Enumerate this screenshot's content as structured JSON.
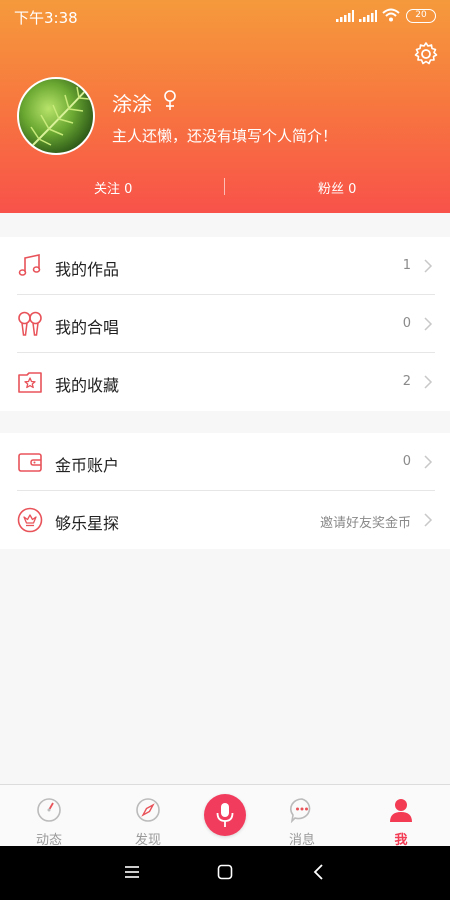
{
  "status_bar": {
    "time": "下午3:38",
    "battery": "20"
  },
  "profile": {
    "name": "涂涂",
    "bio": "主人还懒，还没有填写个人简介！",
    "following": "关注 0",
    "followers": "粉丝 0"
  },
  "menu_group_1": [
    {
      "label": "我的作品",
      "value": "1"
    },
    {
      "label": "我的合唱",
      "value": "0"
    },
    {
      "label": "我的收藏",
      "value": "2"
    }
  ],
  "menu_group_2": [
    {
      "label": "金币账户",
      "value": "0"
    },
    {
      "label": "够乐星探",
      "value": "邀请好友奖金币"
    }
  ],
  "tab_bar": {
    "tabs": [
      {
        "label": "动态",
        "icon": "speedometer-icon"
      },
      {
        "label": "发现",
        "icon": "compass-icon"
      },
      {
        "label": "",
        "icon": "microphone-icon"
      },
      {
        "label": "消息",
        "icon": "chat-bubble-icon"
      },
      {
        "label": "我",
        "icon": "person-icon"
      }
    ],
    "active_tab": "我"
  },
  "colors": {
    "header_top": "#f59a3c",
    "header_bottom": "#f8524a",
    "accent": "#f33b54",
    "icon_red": "#e8535a"
  }
}
